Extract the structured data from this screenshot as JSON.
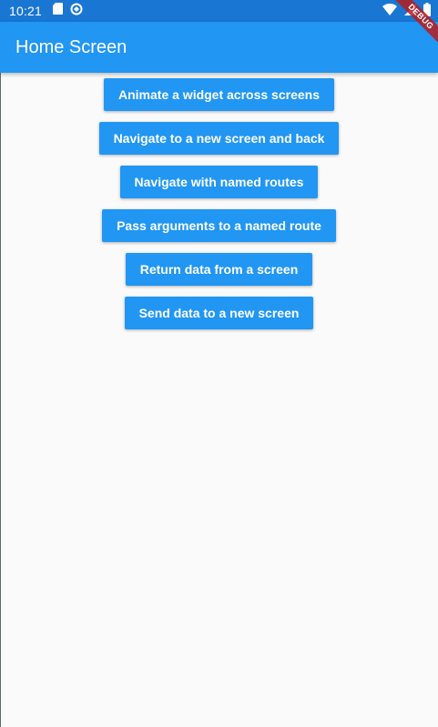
{
  "status_bar": {
    "time": "10:21",
    "icons": [
      "sd-card-icon",
      "sync-icon",
      "wifi-icon",
      "signal-icon",
      "battery-icon"
    ]
  },
  "debug_banner": {
    "label": "DEBUG"
  },
  "app_bar": {
    "title": "Home Screen"
  },
  "buttons": [
    {
      "label": "Animate a widget across screens"
    },
    {
      "label": "Navigate to a new screen and back"
    },
    {
      "label": "Navigate with named routes"
    },
    {
      "label": "Pass arguments to a named route"
    },
    {
      "label": "Return data from a screen"
    },
    {
      "label": "Send data to a new screen"
    }
  ],
  "colors": {
    "primary": "#2196f3",
    "status_bar": "#1976d2",
    "background": "#fafafa",
    "debug_banner": "#b71c1c"
  }
}
